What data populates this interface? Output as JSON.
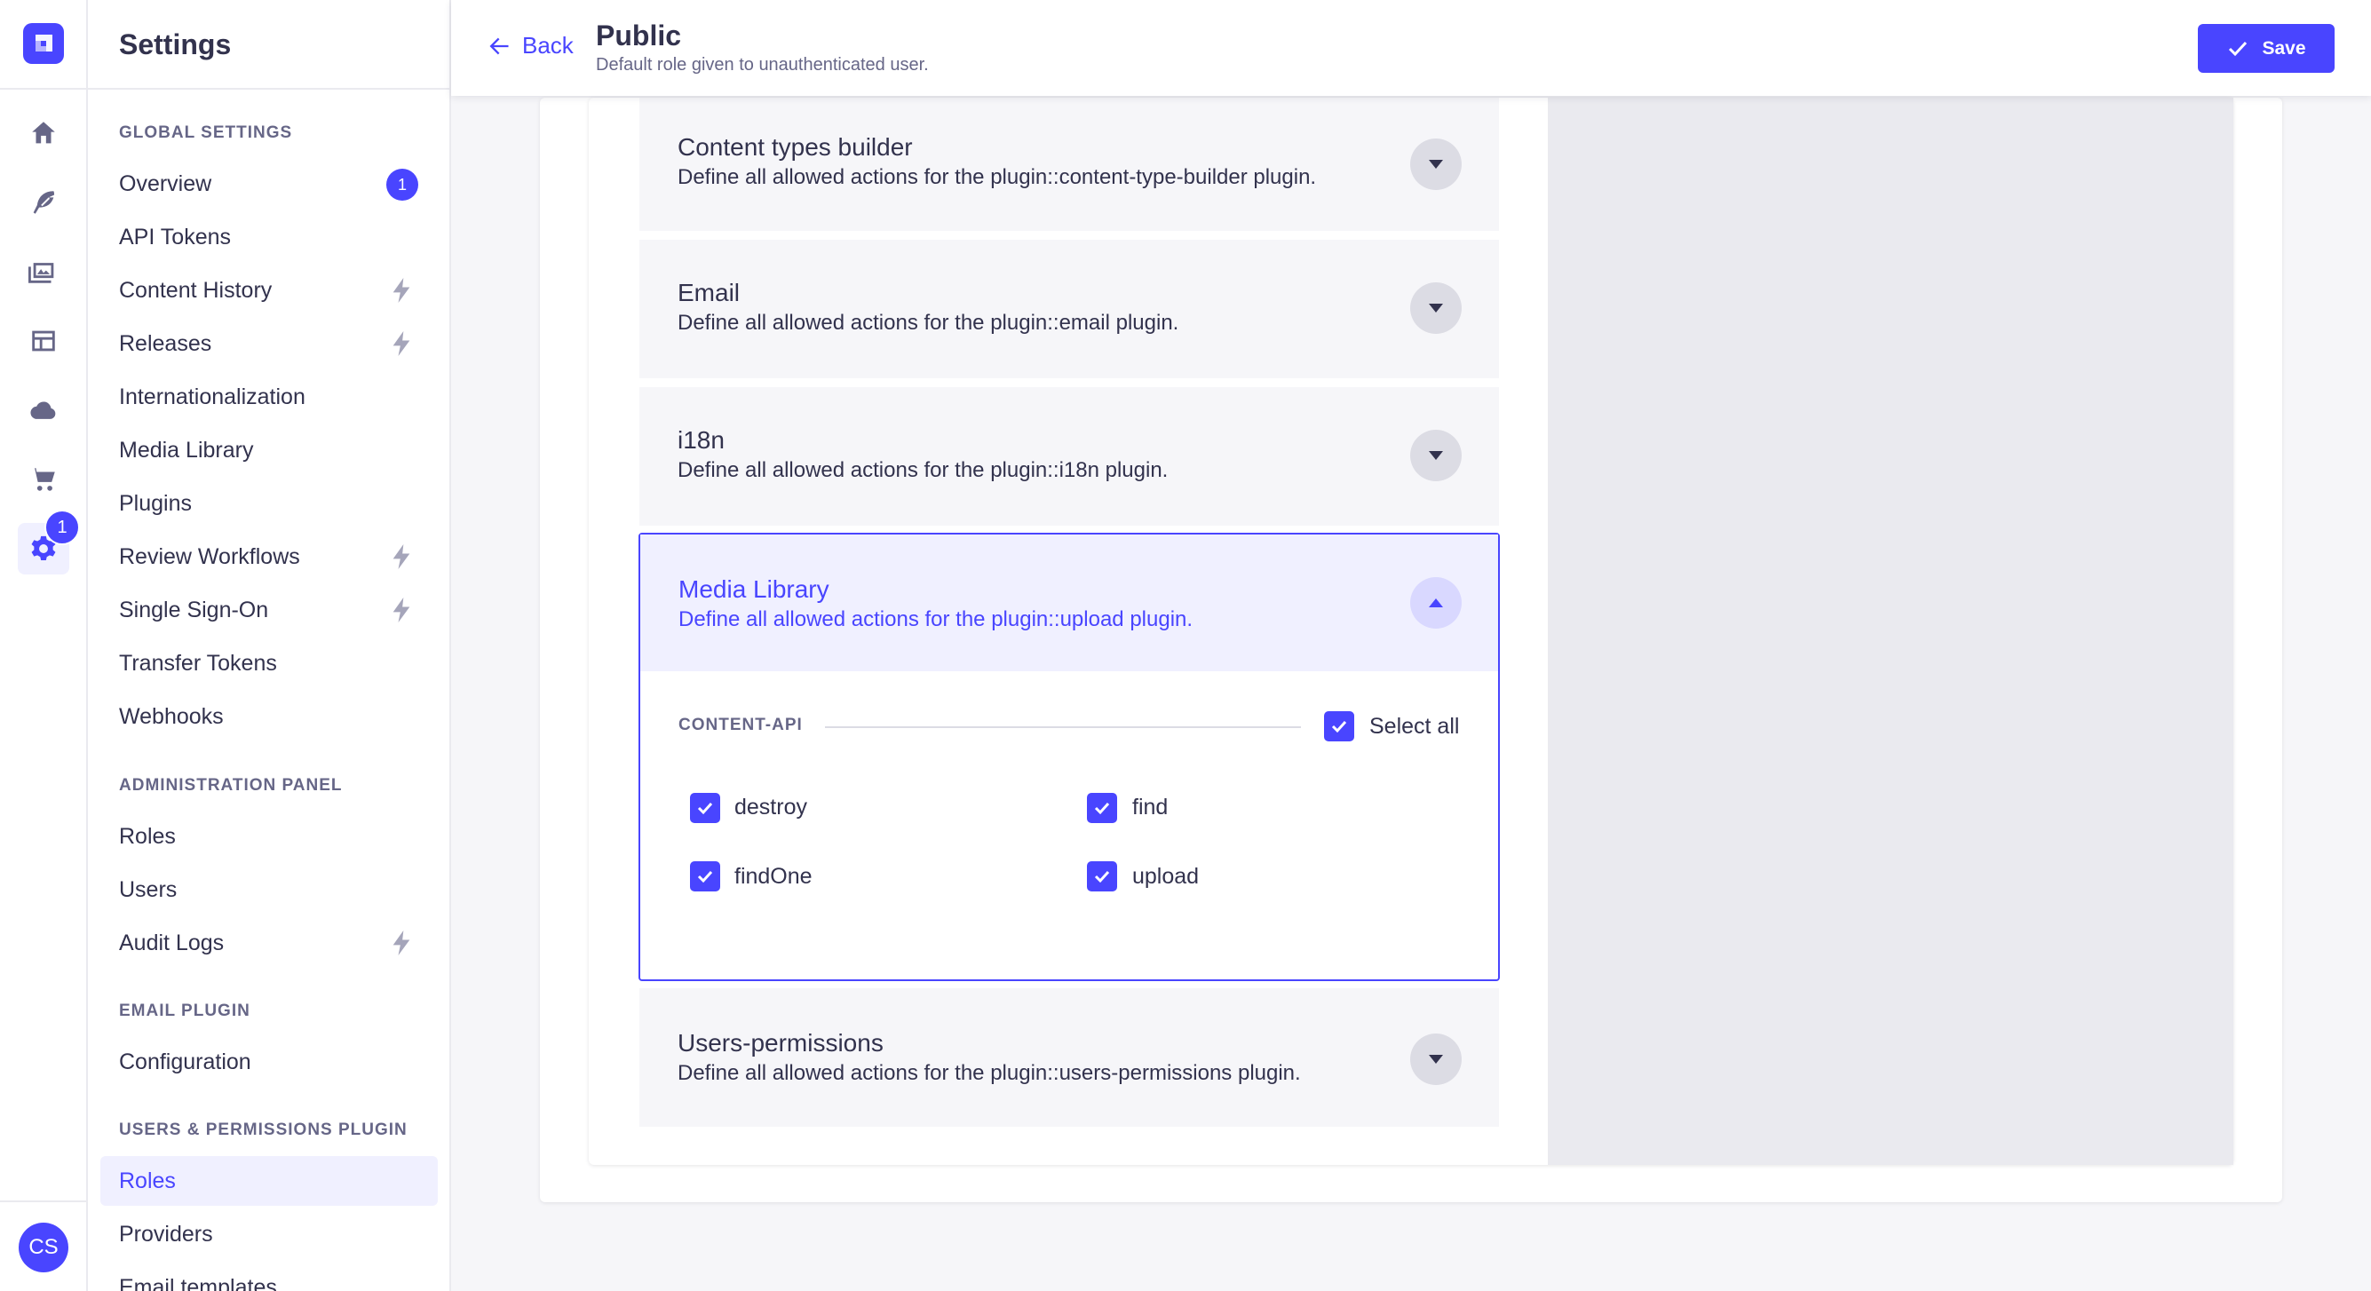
{
  "rail": {
    "icons": [
      "home-icon",
      "feather-icon",
      "images-icon",
      "layout-icon",
      "cloud-icon",
      "cart-icon",
      "gear-icon"
    ],
    "settings_badge": "1",
    "avatar_initials": "CS"
  },
  "sidebar": {
    "title": "Settings",
    "sections": [
      {
        "label": "GLOBAL SETTINGS",
        "items": [
          {
            "label": "Overview",
            "badge": "1"
          },
          {
            "label": "API Tokens"
          },
          {
            "label": "Content History",
            "icon": "lightning-icon"
          },
          {
            "label": "Releases",
            "icon": "lightning-icon"
          },
          {
            "label": "Internationalization"
          },
          {
            "label": "Media Library"
          },
          {
            "label": "Plugins"
          },
          {
            "label": "Review Workflows",
            "icon": "lightning-icon"
          },
          {
            "label": "Single Sign-On",
            "icon": "lightning-icon"
          },
          {
            "label": "Transfer Tokens"
          },
          {
            "label": "Webhooks"
          }
        ]
      },
      {
        "label": "ADMINISTRATION PANEL",
        "items": [
          {
            "label": "Roles"
          },
          {
            "label": "Users"
          },
          {
            "label": "Audit Logs",
            "icon": "lightning-icon"
          }
        ]
      },
      {
        "label": "EMAIL PLUGIN",
        "items": [
          {
            "label": "Configuration"
          }
        ]
      },
      {
        "label": "USERS & PERMISSIONS PLUGIN",
        "items": [
          {
            "label": "Roles",
            "active": true
          },
          {
            "label": "Providers"
          },
          {
            "label": "Email templates"
          }
        ]
      }
    ]
  },
  "header": {
    "back_label": "Back",
    "title": "Public",
    "subtitle": "Default role given to unauthenticated user.",
    "save_label": "Save"
  },
  "accordions": [
    {
      "title": "Content types builder",
      "description": "Define all allowed actions for the plugin::content-type-builder plugin.",
      "expanded": false
    },
    {
      "title": "Email",
      "description": "Define all allowed actions for the plugin::email plugin.",
      "expanded": false
    },
    {
      "title": "i18n",
      "description": "Define all allowed actions for the plugin::i18n plugin.",
      "expanded": false
    },
    {
      "title": "Media Library",
      "description": "Define all allowed actions for the plugin::upload plugin.",
      "expanded": true,
      "group_label": "CONTENT-API",
      "select_all_label": "Select all",
      "select_all_checked": true,
      "permissions": [
        {
          "label": "destroy",
          "checked": true
        },
        {
          "label": "find",
          "checked": true
        },
        {
          "label": "findOne",
          "checked": true
        },
        {
          "label": "upload",
          "checked": true
        }
      ]
    },
    {
      "title": "Users-permissions",
      "description": "Define all allowed actions for the plugin::users-permissions plugin.",
      "expanded": false
    }
  ],
  "colors": {
    "primary": "#4945ff",
    "primary_light": "#f0f0ff",
    "text": "#32324d",
    "muted": "#666687"
  }
}
